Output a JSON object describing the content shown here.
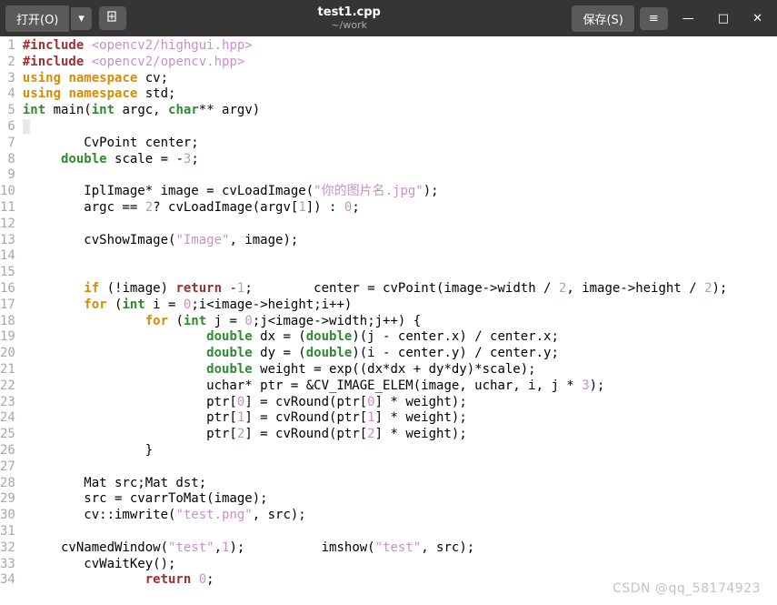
{
  "titlebar": {
    "open": "打开(O)",
    "title": "test1.cpp",
    "subtitle": "~/work",
    "save": "保存(S)"
  },
  "code": {
    "l1a": "#include",
    "l1b": "<opencv2/highgui.hpp>",
    "l2a": "#include",
    "l2b": "<opencv2/opencv.hpp>",
    "l3a": "using",
    "l3b": "namespace",
    "l3c": " cv;",
    "l4a": "using",
    "l4b": "namespace",
    "l4c": " std;",
    "l5a": "int",
    "l5b": " main(",
    "l5c": "int",
    "l5d": " argc, ",
    "l5e": "char",
    "l5f": "** argv)",
    "l6": "{",
    "l7": "        CvPoint center;",
    "l8a": "double",
    "l8b": " scale = -",
    "l8c": "3",
    "l8d": ";",
    "l10a": "        IplImage* image = cvLoadImage(",
    "l10b": "\"你的图片名.jpg\"",
    "l10c": ");",
    "l11a": "        argc == ",
    "l11b": "2",
    "l11c": "? cvLoadImage(argv[",
    "l11d": "1",
    "l11e": "]) : ",
    "l11f": "0",
    "l11g": ";",
    "l13a": "        cvShowImage(",
    "l13b": "\"Image\"",
    "l13c": ", image);",
    "l16a": "if",
    "l16b": " (!image) ",
    "l16c": "return",
    "l16d": " -",
    "l16e": "1",
    "l16f": ";        center = cvPoint(image->width / ",
    "l16g": "2",
    "l16h": ", image->height / ",
    "l16i": "2",
    "l16j": ");",
    "l17a": "for",
    "l17b": " (",
    "l17c": "int",
    "l17d": " i = ",
    "l17e": "0",
    "l17f": ";i<image->height;i++)",
    "l18a": "for",
    "l18b": " (",
    "l18c": "int",
    "l18d": " j = ",
    "l18e": "0",
    "l18f": ";j<image->width;j++) {",
    "l19a": "double",
    "l19b": " dx = (",
    "l19c": "double",
    "l19d": ")(j - center.x) / center.x;",
    "l20a": "double",
    "l20b": " dy = (",
    "l20c": "double",
    "l20d": ")(i - center.y) / center.y;",
    "l21a": "double",
    "l21b": " weight = exp((dx*dx + dy*dy)*scale);",
    "l22a": "                        uchar* ptr = &CV_IMAGE_ELEM(image, uchar, i, j * ",
    "l22b": "3",
    "l22c": ");",
    "l23a": "                        ptr[",
    "l23b": "0",
    "l23c": "] = cvRound(ptr[",
    "l23d": "0",
    "l23e": "] * weight);",
    "l24a": "                        ptr[",
    "l24b": "1",
    "l24c": "] = cvRound(ptr[",
    "l24d": "1",
    "l24e": "] * weight);",
    "l25a": "                        ptr[",
    "l25b": "2",
    "l25c": "] = cvRound(ptr[",
    "l25d": "2",
    "l25e": "] * weight);",
    "l26": "                }",
    "l28": "        Mat src;Mat dst;",
    "l29": "        src = cvarrToMat(image);",
    "l30a": "        cv::imwrite(",
    "l30b": "\"test.png\"",
    "l30c": ", src);",
    "l32a": "     cvNamedWindow(",
    "l32b": "\"test\"",
    "l32c": ",",
    "l32d": "1",
    "l32e": ");          imshow(",
    "l32f": "\"test\"",
    "l32g": ", src);",
    "l33": "        cvWaitKey();",
    "l34a": "return",
    "l34b": " ",
    "l34c": "0",
    "l34d": ";"
  },
  "watermark": "CSDN @qq_58174923"
}
